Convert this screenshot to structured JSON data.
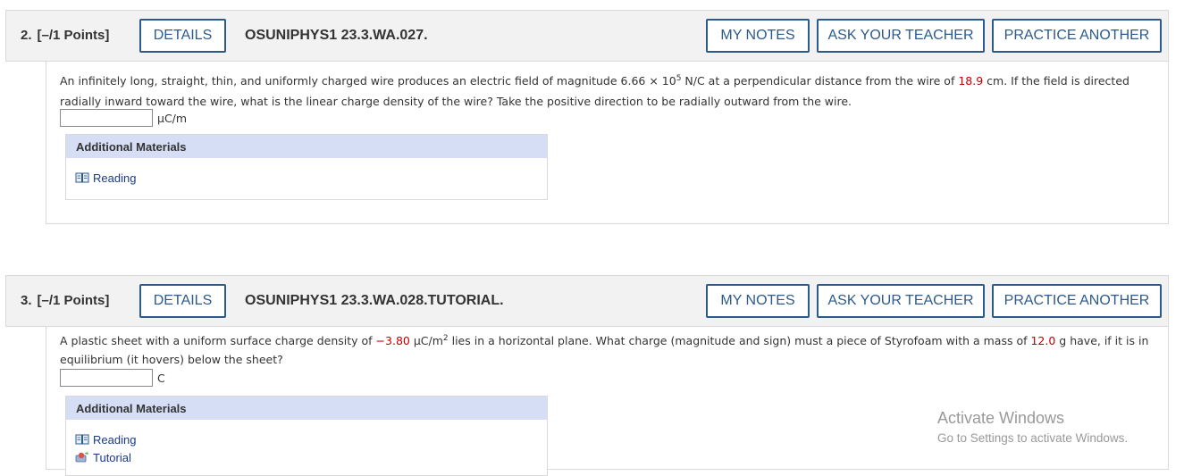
{
  "questions": [
    {
      "number": "2.",
      "points": "[–/1 Points]",
      "details_label": "DETAILS",
      "code": "OSUNIPHYS1 23.3.WA.027.",
      "my_notes_label": "MY NOTES",
      "ask_teacher_label": "ASK YOUR TEACHER",
      "practice_label": "PRACTICE ANOTHER",
      "text": {
        "p1": "An infinitely long, straight, thin, and uniformly charged wire produces an electric field of magnitude ",
        "field_mantissa": "6.66 × 10",
        "field_exp": "5",
        "p2": " N/C at a perpendicular distance from the wire of ",
        "distance": "18.9",
        "p3": " cm. If the field is directed radially inward toward the wire, what is the linear charge density of the wire? Take the positive direction to be radially outward from the wire."
      },
      "answer_value": "",
      "unit": "μC/m",
      "materials_title": "Additional Materials",
      "materials": [
        "Reading"
      ]
    },
    {
      "number": "3.",
      "points": "[–/1 Points]",
      "details_label": "DETAILS",
      "code": "OSUNIPHYS1 23.3.WA.028.TUTORIAL.",
      "my_notes_label": "MY NOTES",
      "ask_teacher_label": "ASK YOUR TEACHER",
      "practice_label": "PRACTICE ANOTHER",
      "text": {
        "p1": "A plastic sheet with a uniform surface charge density of ",
        "density": "−3.80",
        "p2": " μC/m",
        "p2_exp": "2",
        "p3": " lies in a horizontal plane. What charge (magnitude and sign) must a piece of Styrofoam with a mass of ",
        "mass": "12.0",
        "p4": " g have, if it is in equilibrium (it hovers) below the sheet?"
      },
      "answer_value": "",
      "unit": "C",
      "materials_title": "Additional Materials",
      "materials": [
        "Reading",
        "Tutorial"
      ]
    }
  ],
  "watermark": {
    "line1": "Activate Windows",
    "line2": "Go to Settings to activate Windows."
  },
  "colors": {
    "button_border": "#2c5a8c",
    "header_bg": "#f2f2f2",
    "materials_header_bg": "#d6def5",
    "highlight_red": "#c00000",
    "link": "#1a3a8a"
  },
  "icons": [
    "book-icon",
    "tutorial-icon"
  ]
}
